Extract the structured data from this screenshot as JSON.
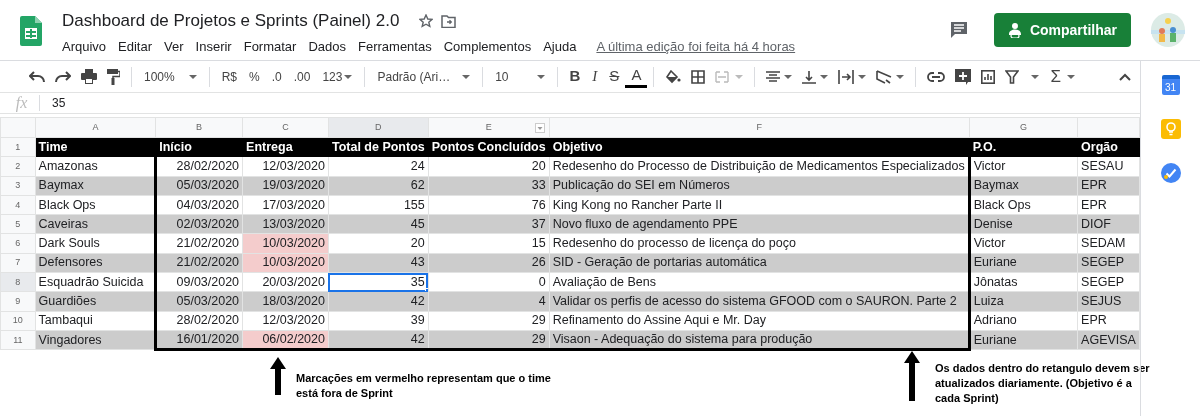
{
  "document": {
    "title": "Dashboard de Projetos e Sprints (Painel) 2.0",
    "last_edit": "A última edição foi feita há 4 horas",
    "share_button": "Compartilhar"
  },
  "menu": [
    "Arquivo",
    "Editar",
    "Ver",
    "Inserir",
    "Formatar",
    "Dados",
    "Ferramentas",
    "Complementos",
    "Ajuda"
  ],
  "toolbar": {
    "zoom": "100%",
    "currency": "R$",
    "percent": "%",
    "decimal_decrease": ".0",
    "decimal_increase": ".00",
    "number_format": "123",
    "font": "Padrão (Ari…",
    "font_size": "10",
    "bold": "B",
    "italic": "I",
    "strikethrough": "S",
    "text_color": "A",
    "functions": "Σ"
  },
  "formula_bar": {
    "label": "fx",
    "value": "35"
  },
  "side_panel": {
    "calendar": "31"
  },
  "columns": [
    {
      "letter": "A",
      "selected": false
    },
    {
      "letter": "B",
      "selected": false
    },
    {
      "letter": "C",
      "selected": false
    },
    {
      "letter": "D",
      "selected": true
    },
    {
      "letter": "E",
      "selected": false
    },
    {
      "letter": "F",
      "selected": false
    },
    {
      "letter": "G",
      "selected": false
    }
  ],
  "header": {
    "number": "1",
    "cells": [
      "Time",
      "Início",
      "Entrega",
      "Total de Pontos",
      "Pontos Concluídos",
      "Objetivo",
      "P.O.",
      "Orgão"
    ]
  },
  "rows": [
    {
      "number": "2",
      "shaded": false,
      "selected": false,
      "late": false,
      "time": "Amazonas",
      "inicio": "28/02/2020",
      "entrega": "12/03/2020",
      "total": "24",
      "concluidos": "20",
      "objetivo": "Redesenho do Processo de Distribuição de Medicamentos Especializados",
      "po": "Victor",
      "orgao": "SESAU"
    },
    {
      "number": "3",
      "shaded": true,
      "selected": false,
      "late": false,
      "time": "Baymax",
      "inicio": "05/03/2020",
      "entrega": "19/03/2020",
      "total": "62",
      "concluidos": "33",
      "objetivo": "Publicação do SEI em Números",
      "po": "Baymax",
      "orgao": "EPR"
    },
    {
      "number": "4",
      "shaded": false,
      "selected": false,
      "late": false,
      "time": "Black Ops",
      "inicio": "04/03/2020",
      "entrega": "17/03/2020",
      "total": "155",
      "concluidos": "76",
      "objetivo": "King Kong no Rancher Parte II",
      "po": "Black Ops",
      "orgao": "EPR"
    },
    {
      "number": "5",
      "shaded": true,
      "selected": false,
      "late": false,
      "time": "Caveiras",
      "inicio": "02/03/2020",
      "entrega": "13/03/2020",
      "total": "45",
      "concluidos": "37",
      "objetivo": "Novo fluxo de agendamento PPE",
      "po": "Denise",
      "orgao": "DIOF"
    },
    {
      "number": "6",
      "shaded": false,
      "selected": false,
      "late": true,
      "time": "Dark Souls",
      "inicio": "21/02/2020",
      "entrega": "10/03/2020",
      "total": "20",
      "concluidos": "15",
      "objetivo": "Redesenho do processo de licença do poço",
      "po": "Victor",
      "orgao": "SEDAM"
    },
    {
      "number": "7",
      "shaded": true,
      "selected": false,
      "late": true,
      "time": "Defensores",
      "inicio": "21/02/2020",
      "entrega": "10/03/2020",
      "total": "43",
      "concluidos": "26",
      "objetivo": "SID - Geração de portarias automática",
      "po": "Euriane",
      "orgao": "SEGEP"
    },
    {
      "number": "8",
      "shaded": false,
      "selected": true,
      "late": false,
      "time": "Esquadrão Suicida",
      "inicio": "09/03/2020",
      "entrega": "20/03/2020",
      "total": "35",
      "concluidos": "0",
      "objetivo": "Avaliação de Bens",
      "po": "Jônatas",
      "orgao": "SEGEP"
    },
    {
      "number": "9",
      "shaded": true,
      "selected": false,
      "late": false,
      "time": "Guardiões",
      "inicio": "05/03/2020",
      "entrega": "18/03/2020",
      "total": "42",
      "concluidos": "4",
      "objetivo": "Validar os perfis de acesso do sistema GFOOD com o SAURON. Parte 2",
      "po": "Luiza",
      "orgao": "SEJUS"
    },
    {
      "number": "10",
      "shaded": false,
      "selected": false,
      "late": false,
      "time": "Tambaqui",
      "inicio": "28/02/2020",
      "entrega": "12/03/2020",
      "total": "39",
      "concluidos": "29",
      "objetivo": "Refinamento do Assine Aqui e Mr. Day",
      "po": "Adriano",
      "orgao": "EPR"
    },
    {
      "number": "11",
      "shaded": true,
      "selected": false,
      "late": true,
      "time": "Vingadores",
      "inicio": "16/01/2020",
      "entrega": "06/02/2020",
      "total": "42",
      "concluidos": "29",
      "objetivo": "Visaon - Adequação do sistema para produção",
      "po": "Euriane",
      "orgao": "AGEVISA"
    }
  ],
  "annotations": [
    "Marcações em vermelho representam que o time está fora de Sprint",
    "Os dados dentro do retangulo devem ser atualizados diariamente. (Objetivo é a cada Sprint)"
  ]
}
